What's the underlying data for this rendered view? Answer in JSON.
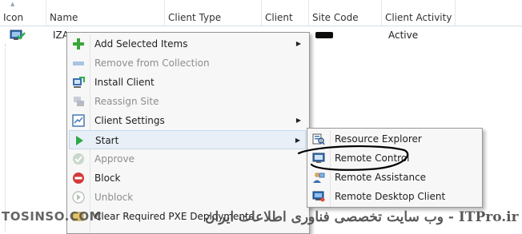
{
  "columns": [
    {
      "key": "icon",
      "label": "Icon"
    },
    {
      "key": "name",
      "label": "Name"
    },
    {
      "key": "client_type",
      "label": "Client Type"
    },
    {
      "key": "client",
      "label": "Client"
    },
    {
      "key": "site_code",
      "label": "Site Code"
    },
    {
      "key": "client_activity",
      "label": "Client Activity"
    }
  ],
  "row": {
    "name": "IZA",
    "client_type": "",
    "client": "",
    "site_code": "",
    "client_activity": "Active"
  },
  "context_menu": {
    "items": [
      {
        "label": "Add Selected Items",
        "icon": "add-icon",
        "submenu": true,
        "disabled": false
      },
      {
        "label": "Remove from Collection",
        "icon": "remove-collection-icon",
        "submenu": false,
        "disabled": true
      },
      {
        "label": "Install Client",
        "icon": "install-client-icon",
        "submenu": false,
        "disabled": false
      },
      {
        "label": "Reassign Site",
        "icon": "reassign-site-icon",
        "submenu": false,
        "disabled": true
      },
      {
        "label": "Client Settings",
        "icon": "client-settings-icon",
        "submenu": true,
        "disabled": false
      },
      {
        "label": "Start",
        "icon": "play-icon",
        "submenu": true,
        "disabled": false,
        "highlighted": true
      },
      {
        "label": "Approve",
        "icon": "approve-icon",
        "submenu": false,
        "disabled": true
      },
      {
        "label": "Block",
        "icon": "block-icon",
        "submenu": false,
        "disabled": false
      },
      {
        "label": "Unblock",
        "icon": "unblock-icon",
        "submenu": false,
        "disabled": true
      },
      {
        "label": "Clear Required PXE Deployments",
        "icon": "pxe-icon",
        "submenu": false,
        "disabled": false
      }
    ]
  },
  "start_submenu": {
    "items": [
      {
        "label": "Resource Explorer",
        "icon": "resource-explorer-icon"
      },
      {
        "label": "Remote Control",
        "icon": "remote-control-icon"
      },
      {
        "label": "Remote Assistance",
        "icon": "remote-assistance-icon"
      },
      {
        "label": "Remote Desktop Client",
        "icon": "remote-desktop-icon"
      }
    ]
  },
  "watermark": {
    "left": "TOSINSO.COM",
    "right": "وب سایت تخصصی فناوری اطلاعات ایران - ITPro.ir"
  },
  "colors": {
    "menu_bg": "#f7f7f7",
    "highlight_bg": "#e8eff7",
    "disabled_text": "#8d8d8d",
    "annotation_stroke": "#000000"
  }
}
